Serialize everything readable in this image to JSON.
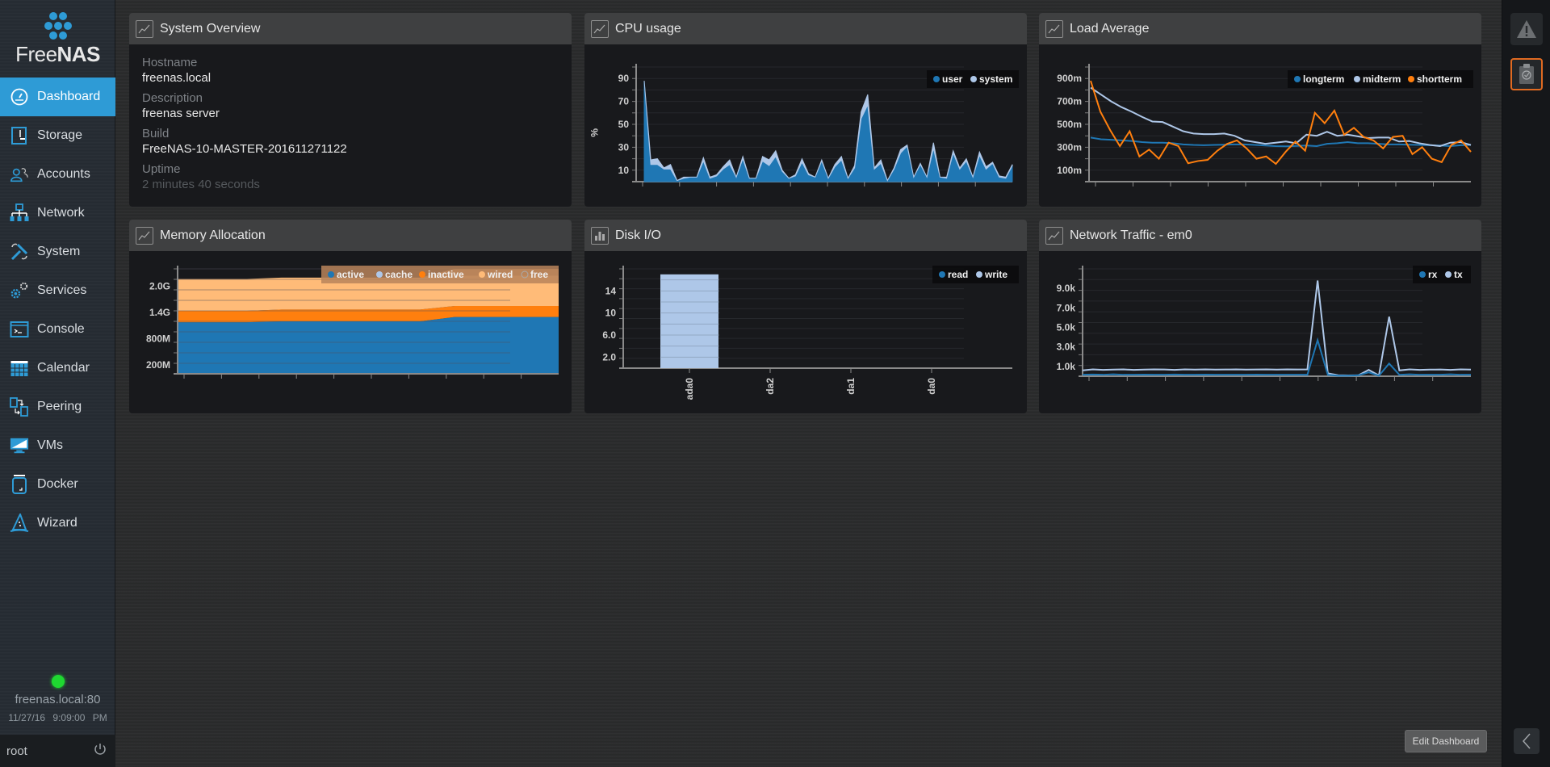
{
  "app": {
    "name_light": "Free",
    "name_bold": "NAS"
  },
  "sidebar": {
    "items": [
      {
        "label": "Dashboard",
        "icon": "gauge-icon",
        "active": true
      },
      {
        "label": "Storage",
        "icon": "storage-icon"
      },
      {
        "label": "Accounts",
        "icon": "users-icon"
      },
      {
        "label": "Network",
        "icon": "network-icon"
      },
      {
        "label": "System",
        "icon": "wrench-icon"
      },
      {
        "label": "Services",
        "icon": "gears-icon"
      },
      {
        "label": "Console",
        "icon": "terminal-icon"
      },
      {
        "label": "Calendar",
        "icon": "calendar-icon"
      },
      {
        "label": "Peering",
        "icon": "peering-icon"
      },
      {
        "label": "VMs",
        "icon": "monitor-icon"
      },
      {
        "label": "Docker",
        "icon": "docker-icon"
      },
      {
        "label": "Wizard",
        "icon": "wizard-hat-icon"
      }
    ],
    "status": {
      "host": "freenas.local:80",
      "date": "11/27/16",
      "time": "9:09:00 PM",
      "connection_color": "#1fd831"
    },
    "user": "root"
  },
  "colors": {
    "accent": "#2e9bd6",
    "series_blue": "#1f77b4",
    "series_lightblue": "#aec7e8",
    "series_orange": "#ff7f0e",
    "series_peach": "#ffbb78",
    "alert_border": "#e06a21"
  },
  "widgets": {
    "overview": {
      "title": "System Overview",
      "fields": [
        {
          "label": "Hostname",
          "value": "freenas.local"
        },
        {
          "label": "Description",
          "value": "freenas server"
        },
        {
          "label": "Build",
          "value": "FreeNAS-10-MASTER-201611271122"
        },
        {
          "label": "Uptime",
          "value": "2 minutes 40 seconds"
        }
      ]
    },
    "cpu": {
      "title": "CPU usage"
    },
    "load": {
      "title": "Load Average"
    },
    "memory": {
      "title": "Memory Allocation"
    },
    "disk": {
      "title": "Disk I/O"
    },
    "network": {
      "title": "Network Traffic - em0"
    }
  },
  "footer": {
    "edit_dashboard": "Edit Dashboard"
  },
  "chart_data": [
    {
      "id": "cpu",
      "type": "area",
      "title": "CPU usage",
      "ylabel": "%",
      "yticks": [
        "10",
        "30",
        "50",
        "70",
        "90"
      ],
      "ylim": [
        0,
        100
      ],
      "legend": "top-right",
      "series": [
        {
          "name": "user",
          "color": "#1f77b4",
          "values": [
            88,
            15,
            15,
            11,
            11,
            1,
            3,
            4,
            4,
            18,
            3,
            5,
            11,
            15,
            4,
            20,
            3,
            3,
            18,
            14,
            22,
            9,
            3,
            5,
            17,
            6,
            4,
            18,
            3,
            13,
            19,
            3,
            12,
            55,
            67,
            11,
            16,
            1,
            11,
            25,
            31,
            4,
            15,
            4,
            29,
            4,
            3,
            25,
            11,
            18,
            4,
            23,
            11,
            16,
            4,
            3,
            14
          ]
        },
        {
          "name": "system",
          "color": "#aec7e8",
          "values": [
            0,
            4,
            5,
            1,
            4,
            0,
            1,
            0,
            0,
            3,
            1,
            1,
            2,
            4,
            0,
            2,
            0,
            0,
            4,
            5,
            5,
            1,
            0,
            1,
            3,
            1,
            0,
            1,
            0,
            2,
            3,
            0,
            2,
            6,
            9,
            1,
            3,
            0,
            1,
            3,
            1,
            0,
            1,
            0,
            5,
            0,
            1,
            2,
            1,
            2,
            0,
            3,
            2,
            1,
            1,
            1,
            1
          ]
        }
      ]
    },
    {
      "id": "load",
      "type": "line",
      "title": "Load Average",
      "yticks": [
        "100m",
        "300m",
        "500m",
        "700m",
        "900m"
      ],
      "ylim": [
        0,
        1000
      ],
      "legend": "top-right",
      "series": [
        {
          "name": "longterm",
          "color": "#1f77b4",
          "values": [
            385,
            370,
            365,
            360,
            355,
            345,
            340,
            340,
            335,
            325,
            320,
            318,
            320,
            322,
            325,
            325,
            320,
            315,
            310,
            308,
            312,
            315,
            310,
            330,
            335,
            345,
            335,
            335,
            330,
            325,
            325,
            322,
            320,
            318,
            315,
            310,
            318,
            320
          ]
        },
        {
          "name": "midterm",
          "color": "#aec7e8",
          "values": [
            820,
            760,
            700,
            650,
            610,
            565,
            525,
            520,
            480,
            440,
            420,
            415,
            415,
            420,
            400,
            360,
            345,
            330,
            340,
            350,
            335,
            410,
            400,
            435,
            400,
            410,
            395,
            380,
            385,
            385,
            350,
            355,
            335,
            320,
            310,
            340,
            345,
            320
          ]
        },
        {
          "name": "shortterm",
          "color": "#ff7f0e",
          "values": [
            880,
            610,
            450,
            310,
            440,
            220,
            280,
            200,
            340,
            310,
            160,
            180,
            190,
            270,
            330,
            360,
            290,
            200,
            220,
            155,
            260,
            350,
            270,
            600,
            510,
            620,
            410,
            470,
            390,
            360,
            290,
            390,
            400,
            240,
            300,
            200,
            170,
            320,
            360,
            260
          ]
        }
      ]
    },
    {
      "id": "memory",
      "type": "area",
      "title": "Memory Allocation",
      "yticks": [
        "200M",
        "800M",
        "1.4G",
        "2.0G"
      ],
      "ylim": [
        0,
        2400
      ],
      "legend": "top-right",
      "series": [
        {
          "name": "active",
          "color": "#1f77b4",
          "values": [
            1180,
            1180,
            1180,
            1200,
            1200,
            1200,
            1200,
            1200,
            1300,
            1300,
            1300,
            1300
          ]
        },
        {
          "name": "cache",
          "color": "#aec7e8",
          "values": [
            0,
            0,
            0,
            0,
            0,
            0,
            0,
            0,
            0,
            0,
            0,
            0
          ]
        },
        {
          "name": "inactive",
          "color": "#ff7f0e",
          "values": [
            260,
            260,
            260,
            270,
            270,
            270,
            270,
            270,
            250,
            250,
            250,
            250
          ]
        },
        {
          "name": "wired",
          "color": "#ffbb78",
          "values": [
            730,
            730,
            730,
            730,
            730,
            730,
            730,
            730,
            700,
            700,
            700,
            700
          ]
        },
        {
          "name": "free",
          "color": "#ffffff",
          "values": [
            0,
            0,
            0,
            0,
            0,
            0,
            0,
            0,
            150,
            150,
            150,
            150
          ]
        }
      ]
    },
    {
      "id": "disk",
      "type": "bar",
      "title": "Disk I/O",
      "categories": [
        "ada0",
        "da2",
        "da1",
        "da0"
      ],
      "yticks": [
        "2.0",
        "6.0",
        "10",
        "14"
      ],
      "ylim": [
        0,
        18
      ],
      "legend": "top-right",
      "series": [
        {
          "name": "read",
          "color": "#1f77b4",
          "values": [
            0,
            0,
            0,
            0
          ]
        },
        {
          "name": "write",
          "color": "#aec7e8",
          "values": [
            17,
            0,
            0,
            0
          ]
        }
      ]
    },
    {
      "id": "network",
      "type": "line",
      "title": "Network Traffic - em0",
      "yticks": [
        "1.0k",
        "3.0k",
        "5.0k",
        "7.0k",
        "9.0k"
      ],
      "ylim": [
        0,
        11000
      ],
      "legend": "top-right",
      "series": [
        {
          "name": "rx",
          "color": "#1f77b4",
          "values": [
            150,
            180,
            150,
            200,
            150,
            150,
            170,
            160,
            150,
            180,
            160,
            150,
            170,
            160,
            150,
            150,
            160,
            170,
            150,
            150,
            150,
            160,
            150,
            3700,
            150,
            50,
            50,
            100,
            400,
            50,
            1300,
            150,
            200,
            150,
            150,
            160,
            200,
            150,
            150
          ]
        },
        {
          "name": "tx",
          "color": "#aec7e8",
          "values": [
            600,
            700,
            650,
            680,
            700,
            650,
            680,
            700,
            690,
            650,
            700,
            680,
            700,
            680,
            690,
            700,
            680,
            690,
            700,
            680,
            700,
            690,
            700,
            9800,
            300,
            100,
            80,
            100,
            650,
            80,
            6100,
            600,
            700,
            650,
            680,
            690,
            650,
            700,
            680
          ]
        }
      ]
    }
  ]
}
